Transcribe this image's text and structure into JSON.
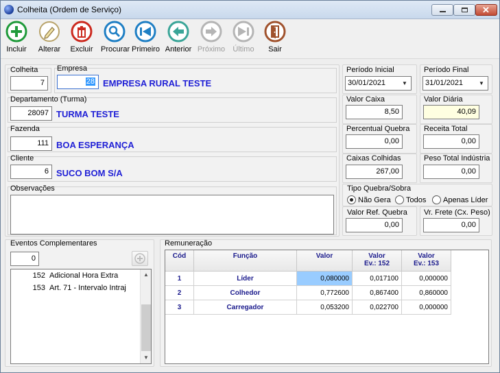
{
  "window": {
    "title": "Colheita (Ordem de Serviço)"
  },
  "toolbar": {
    "incluir": "Incluir",
    "alterar": "Alterar",
    "excluir": "Excluir",
    "procurar": "Procurar",
    "primeiro": "Primeiro",
    "anterior": "Anterior",
    "proximo": "Próximo",
    "ultimo": "Último",
    "sair": "Sair"
  },
  "form": {
    "colheita_label": "Colheita",
    "colheita_value": "7",
    "empresa_label": "Empresa",
    "empresa_code": "28",
    "empresa_name": "EMPRESA RURAL TESTE",
    "periodo_inicial_label": "Período Inicial",
    "periodo_inicial_value": "30/01/2021",
    "periodo_final_label": "Período Final",
    "periodo_final_value": "31/01/2021",
    "departamento_label": "Departamento (Turma)",
    "departamento_code": "28097",
    "departamento_name": "TURMA TESTE",
    "valor_caixa_label": "Valor Caixa",
    "valor_caixa_value": "8,50",
    "valor_diaria_label": "Valor Diária",
    "valor_diaria_value": "40,09",
    "fazenda_label": "Fazenda",
    "fazenda_code": "111",
    "fazenda_name": "BOA ESPERANÇA",
    "percentual_quebra_label": "Percentual Quebra",
    "percentual_quebra_value": "0,00",
    "receita_total_label": "Receita Total",
    "receita_total_value": "0,00",
    "cliente_label": "Cliente",
    "cliente_code": "6",
    "cliente_name": "SUCO BOM S/A",
    "caixas_colhidas_label": "Caixas Colhidas",
    "caixas_colhidas_value": "267,00",
    "peso_total_label": "Peso Total Indústria",
    "peso_total_value": "0,00",
    "observacoes_label": "Observações",
    "tipo_quebra_label": "Tipo Quebra/Sobra",
    "tipo_quebra_options": [
      "Não Gera",
      "Todos",
      "Apenas Líder"
    ],
    "tipo_quebra_selected": "Não Gera",
    "valor_ref_quebra_label": "Valor Ref. Quebra",
    "valor_ref_quebra_value": "0,00",
    "vr_frete_label": "Vr. Frete (Cx. Peso)",
    "vr_frete_value": "0,00"
  },
  "eventos": {
    "label": "Eventos Complementares",
    "count": "0",
    "items": [
      {
        "code": "152",
        "desc": "Adicional Hora Extra"
      },
      {
        "code": "153",
        "desc": "Art. 71 - Intervalo Intraj"
      }
    ]
  },
  "remuneracao": {
    "label": "Remuneração",
    "headers": [
      "Cód",
      "Função",
      "Valor",
      "Valor Ev.: 152",
      "Valor Ev.: 153"
    ],
    "header_lines": [
      [
        "Cód"
      ],
      [
        "Função"
      ],
      [
        "Valor"
      ],
      [
        "Valor",
        "Ev.: 152"
      ],
      [
        "Valor",
        "Ev.: 153"
      ]
    ],
    "rows": [
      {
        "cod": "1",
        "funcao": "Líder",
        "valor": "0,080000",
        "ev152": "0,017100",
        "ev153": "0,000000"
      },
      {
        "cod": "2",
        "funcao": "Colhedor",
        "valor": "0,772600",
        "ev152": "0,867400",
        "ev153": "0,860000"
      },
      {
        "cod": "3",
        "funcao": "Carregador",
        "valor": "0,053200",
        "ev152": "0,022700",
        "ev153": "0,000000"
      }
    ]
  }
}
